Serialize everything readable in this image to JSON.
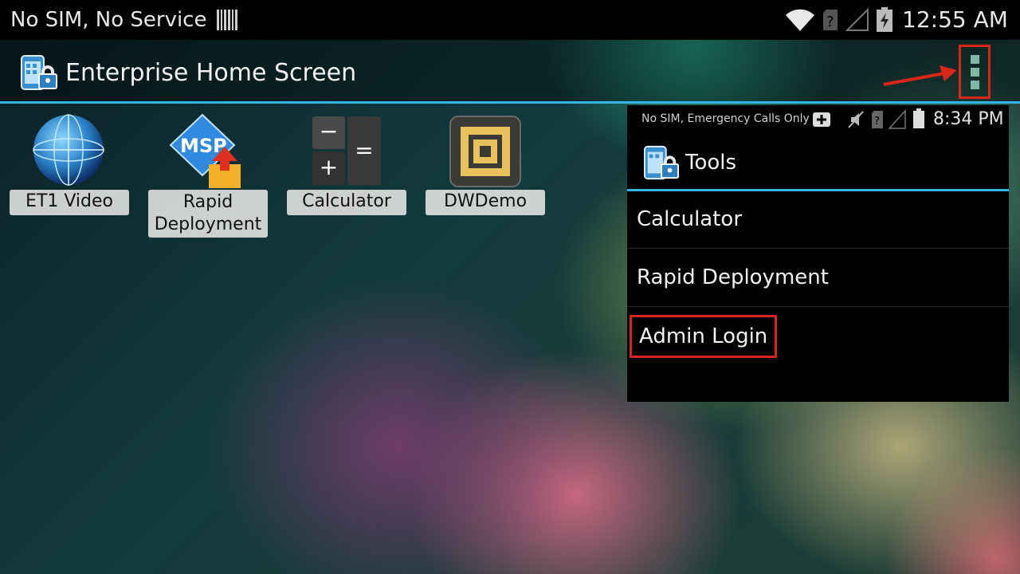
{
  "status_bar": {
    "carrier": "No SIM, No Service",
    "time": "12:55 AM",
    "icons": [
      "barcode-scanner-icon",
      "wifi-icon",
      "no-sim-icon",
      "signal-icon",
      "battery-charging-icon"
    ]
  },
  "action_bar": {
    "title": "Enterprise Home Screen",
    "overflow_icon": "overflow-menu-icon",
    "highlight_color": "#d8261a",
    "accent_color": "#33b5e5"
  },
  "apps": [
    {
      "label": "ET1 Video",
      "icon": "globe-icon"
    },
    {
      "label": "Rapid Deployment",
      "icon": "msp-icon",
      "icon_text": "MSP"
    },
    {
      "label": "Calculator",
      "icon": "calculator-icon",
      "icon_symbols": [
        "−",
        "=",
        "+"
      ]
    },
    {
      "label": "DWDemo",
      "icon": "dwdemo-icon"
    }
  ],
  "tools_panel": {
    "status_carrier": "No SIM, Emergency Calls Only",
    "status_time": "8:34 PM",
    "title": "Tools",
    "items": [
      {
        "label": "Calculator"
      },
      {
        "label": "Rapid Deployment"
      },
      {
        "label": "Admin Login",
        "highlighted": true
      }
    ]
  }
}
